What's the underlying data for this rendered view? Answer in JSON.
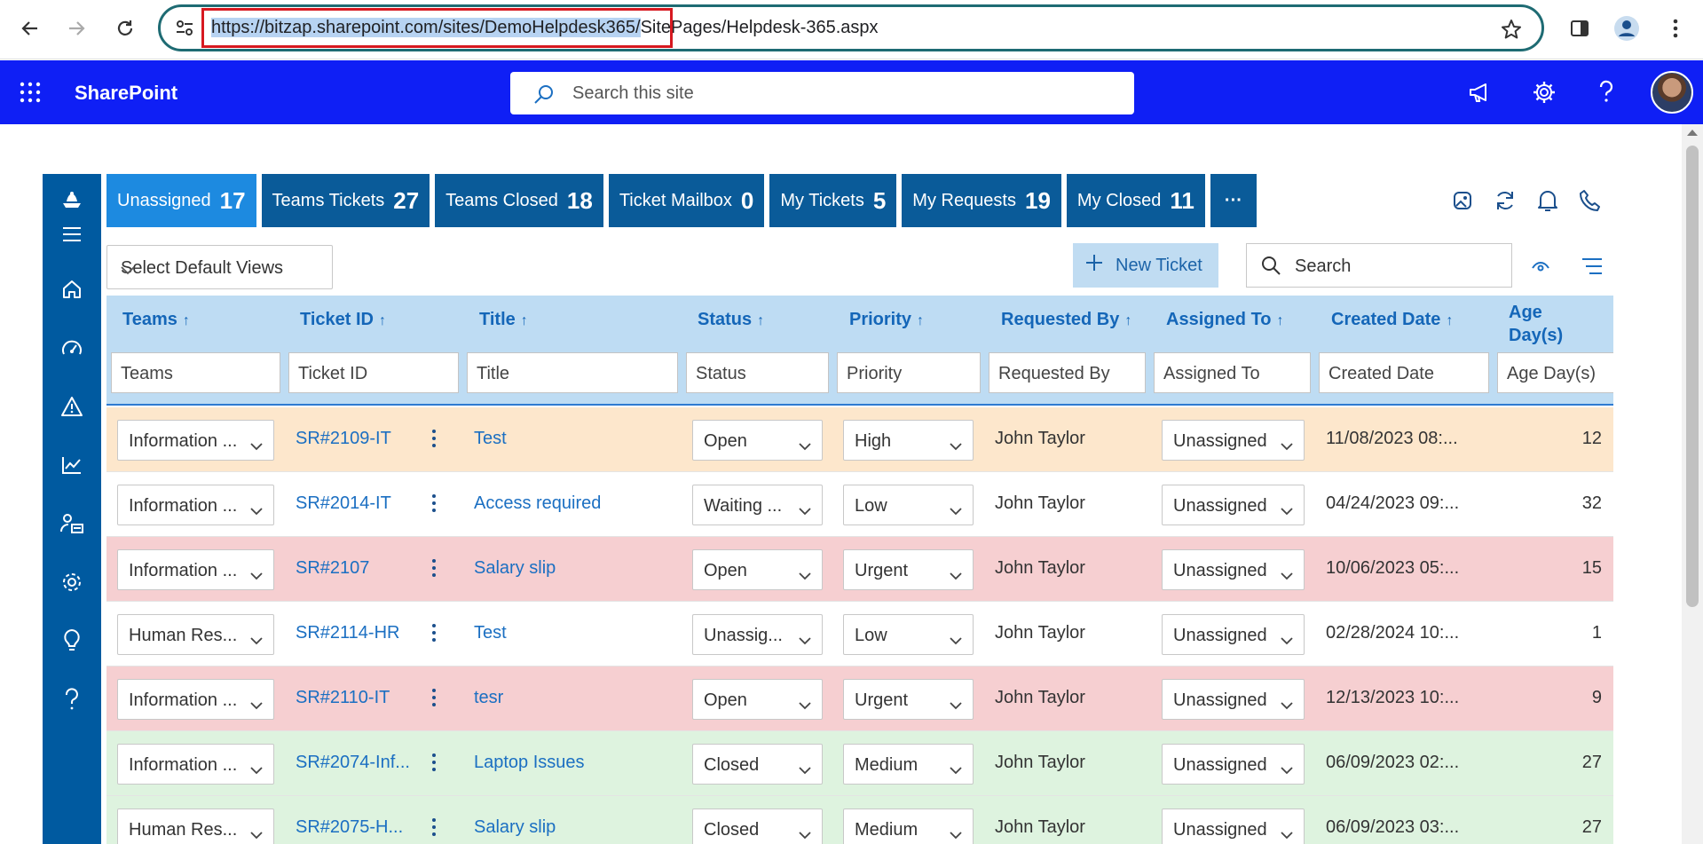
{
  "browser": {
    "url_highlighted": "https://bitzap.sharepoint.com/sites/DemoHelpdesk365/",
    "url_rest": "SitePages/Helpdesk-365.aspx"
  },
  "suite": {
    "brand": "SharePoint",
    "search_placeholder": "Search this site"
  },
  "tabs": [
    {
      "label": "Unassigned",
      "count": "17",
      "active": true
    },
    {
      "label": "Teams Tickets",
      "count": "27"
    },
    {
      "label": "Teams Closed",
      "count": "18"
    },
    {
      "label": "Ticket Mailbox",
      "count": "0"
    },
    {
      "label": "My Tickets",
      "count": "5"
    },
    {
      "label": "My Requests",
      "count": "19"
    },
    {
      "label": "My Closed",
      "count": "11"
    }
  ],
  "more_label": "···",
  "toolbar": {
    "views_label": "Select Default Views",
    "new_ticket_label": "New Ticket",
    "search_placeholder": "Search"
  },
  "columns": {
    "teams": "Teams",
    "ticket_id": "Ticket ID",
    "title": "Title",
    "status": "Status",
    "priority": "Priority",
    "requested_by": "Requested By",
    "assigned_to": "Assigned To",
    "created_date": "Created Date",
    "age_line1": "Age",
    "age_line2": "Day(s)",
    "sort_arrow": "↑"
  },
  "filters": {
    "teams": "Teams",
    "ticket_id": "Ticket ID",
    "title": "Title",
    "status": "Status",
    "priority": "Priority",
    "requested_by": "Requested By",
    "assigned_to": "Assigned To",
    "created_date": "Created Date",
    "age": "Age Day(s)"
  },
  "rows": [
    {
      "team": "Information ...",
      "id": "SR#2109-IT",
      "title": "Test",
      "status": "Open",
      "priority": "High",
      "requested_by": "John Taylor",
      "assigned_to": "Unassigned",
      "created": "11/08/2023 08:...",
      "age": "12",
      "bg": "#fde7cc"
    },
    {
      "team": "Information ...",
      "id": "SR#2014-IT",
      "title": "Access required",
      "status": "Waiting ...",
      "priority": "Low",
      "requested_by": "John Taylor",
      "assigned_to": "Unassigned",
      "created": "04/24/2023 09:...",
      "age": "32",
      "bg": "#ffffff"
    },
    {
      "team": "Information ...",
      "id": "SR#2107",
      "title": "Salary slip",
      "status": "Open",
      "priority": "Urgent",
      "requested_by": "John Taylor",
      "assigned_to": "Unassigned",
      "created": "10/06/2023 05:...",
      "age": "15",
      "bg": "#f6cfd1"
    },
    {
      "team": "Human Res...",
      "id": "SR#2114-HR",
      "title": "Test",
      "status": "Unassig...",
      "priority": "Low",
      "requested_by": "John Taylor",
      "assigned_to": "Unassigned",
      "created": "02/28/2024 10:...",
      "age": "1",
      "bg": "#ffffff"
    },
    {
      "team": "Information ...",
      "id": "SR#2110-IT",
      "title": "tesr",
      "status": "Open",
      "priority": "Urgent",
      "requested_by": "John Taylor",
      "assigned_to": "Unassigned",
      "created": "12/13/2023 10:...",
      "age": "9",
      "bg": "#f6cfd1"
    },
    {
      "team": "Information ...",
      "id": "SR#2074-Inf...",
      "title": "Laptop Issues",
      "status": "Closed",
      "priority": "Medium",
      "requested_by": "John Taylor",
      "assigned_to": "Unassigned",
      "created": "06/09/2023 02:...",
      "age": "27",
      "bg": "#def3df"
    },
    {
      "team": "Human Res...",
      "id": "SR#2075-H...",
      "title": "Salary slip",
      "status": "Closed",
      "priority": "Medium",
      "requested_by": "John Taylor",
      "assigned_to": "Unassigned",
      "created": "06/09/2023 03:...",
      "age": "27",
      "bg": "#def3df"
    }
  ],
  "colors": {
    "suitebar": "#0f1ff5",
    "rail": "#005aa0",
    "tab": "#0a5b99",
    "tab_active": "#1d8ae0",
    "header": "#bedcf3",
    "link": "#1b6fc2"
  }
}
